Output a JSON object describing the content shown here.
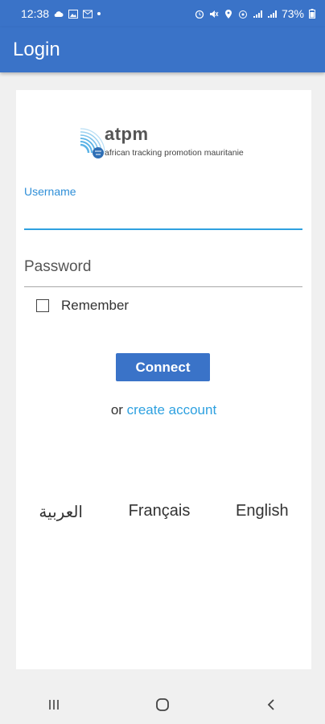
{
  "status_bar": {
    "time": "12:38",
    "battery": "73%"
  },
  "app_bar": {
    "title": "Login"
  },
  "logo": {
    "name": "atpm",
    "tagline": "african tracking promotion mauritanie"
  },
  "form": {
    "username_label": "Username",
    "username_value": "",
    "password_placeholder": "Password",
    "remember_label": "Remember",
    "remember_checked": false,
    "connect_label": "Connect",
    "or_text": "or",
    "create_account_label": "create account"
  },
  "languages": [
    "العربية",
    "Français",
    "English"
  ],
  "colors": {
    "primary": "#3a73c8",
    "accent": "#2ea1e0"
  },
  "nav": {
    "icons": [
      "recent-apps-icon",
      "home-icon",
      "back-icon"
    ]
  }
}
